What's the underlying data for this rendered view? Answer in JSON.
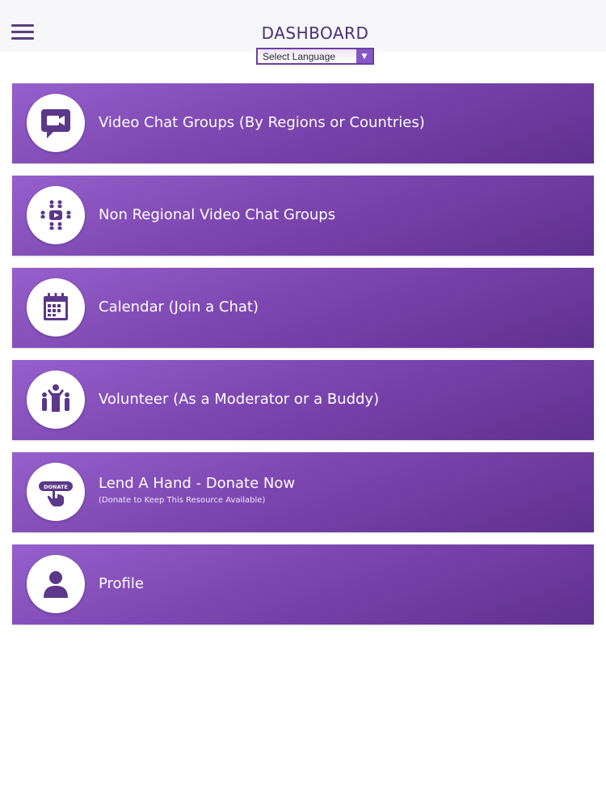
{
  "header": {
    "title": "DASHBOARD",
    "language_select": {
      "selected": "Select Language"
    }
  },
  "menu": {
    "items": [
      {
        "label": "Video Chat Groups (By Regions or Countries)",
        "icon": "video-camera-icon"
      },
      {
        "label": "Non Regional Video Chat Groups",
        "icon": "group-video-icon"
      },
      {
        "label": "Calendar (Join a Chat)",
        "icon": "calendar-icon"
      },
      {
        "label": "Volunteer (As a Moderator or a Buddy)",
        "icon": "volunteer-people-icon"
      },
      {
        "label": "Lend A Hand - Donate Now",
        "sublabel": "(Donate to Keep This Resource Available)",
        "icon": "donate-hand-icon",
        "icon_text": "DONATE"
      },
      {
        "label": "Profile",
        "icon": "profile-person-icon"
      }
    ]
  },
  "colors": {
    "accent": "#4b2f74",
    "item_gradient_start": "#9660cc",
    "item_gradient_end": "#5f3090",
    "icon": "#5b3889"
  }
}
